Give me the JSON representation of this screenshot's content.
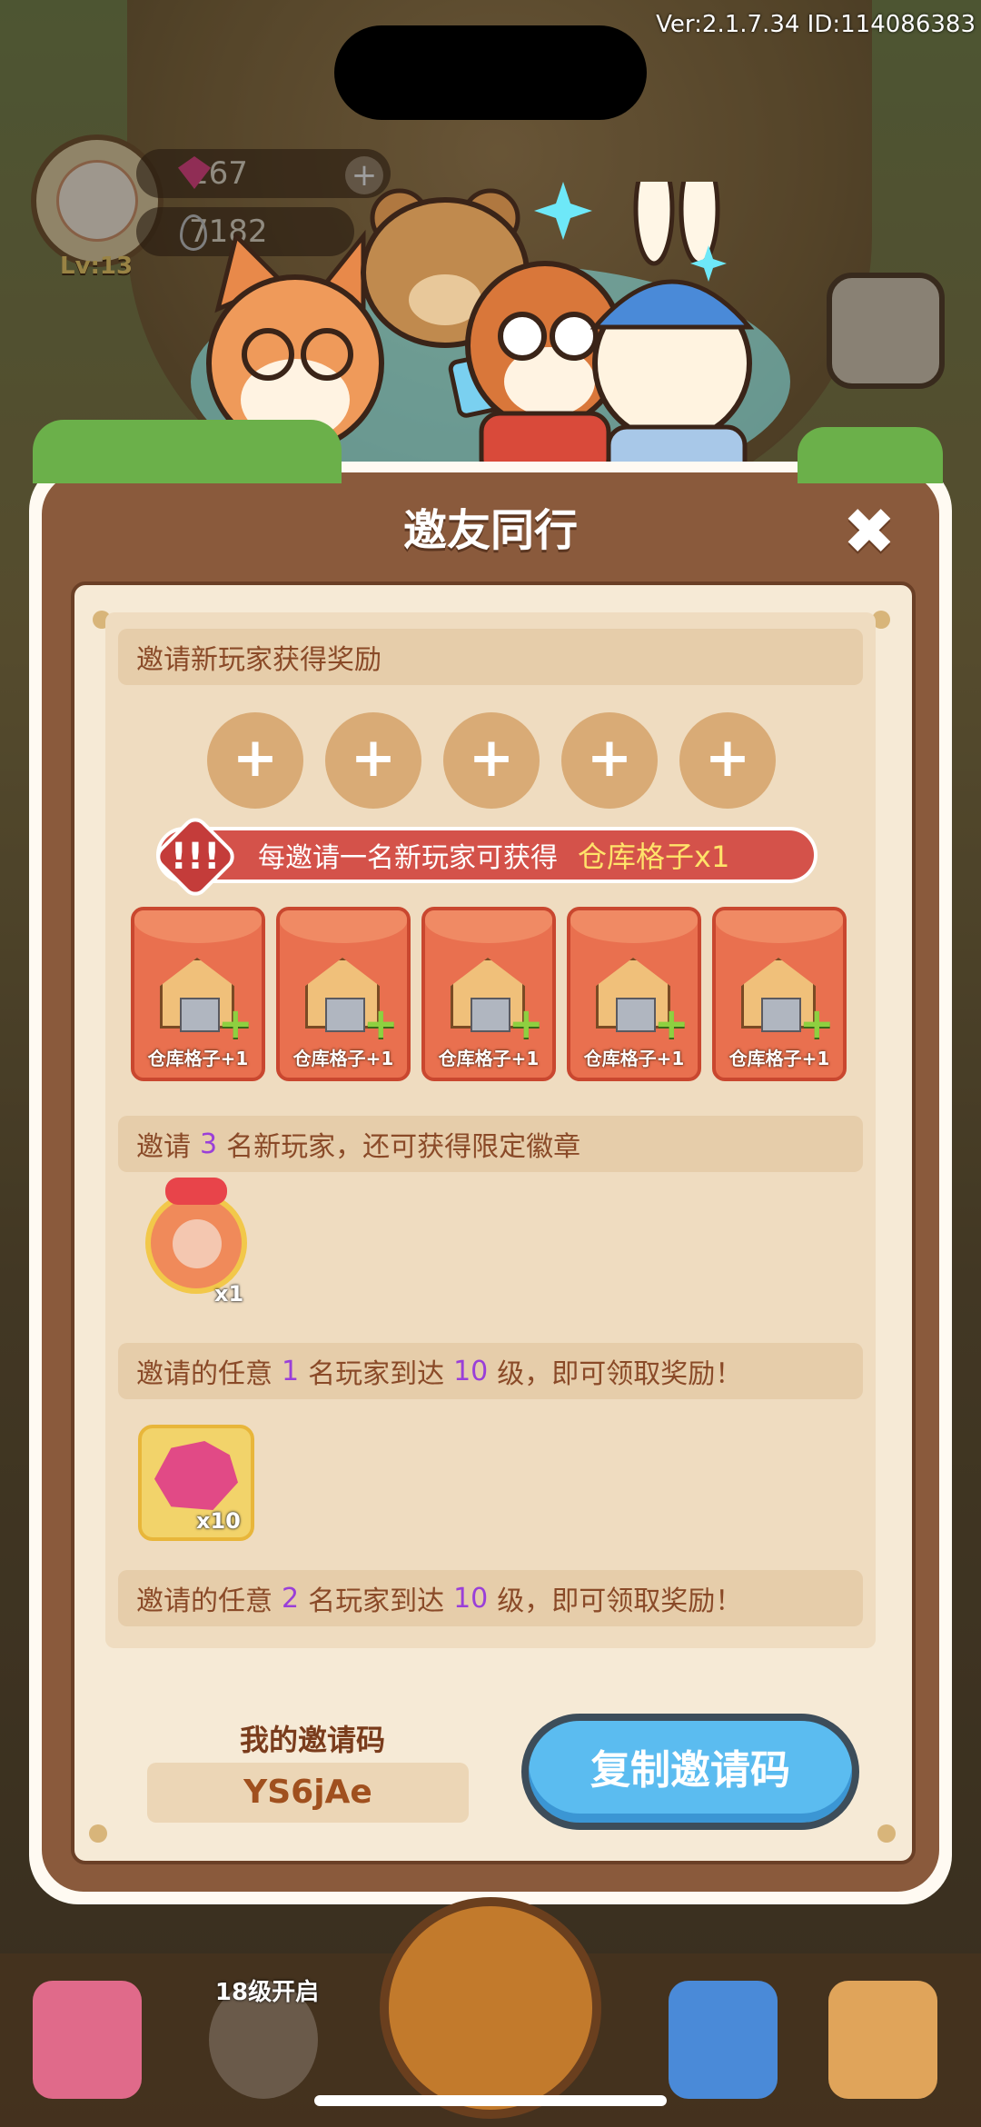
{
  "status": {
    "version_text": "Ver:2.1.7.34 ID:114086383"
  },
  "player": {
    "level": "Lv:13",
    "gems": "167",
    "seeds": "7182"
  },
  "dialog": {
    "title": "邀友同行",
    "close_icon": "close-icon",
    "section_invite_reward": "邀请新玩家获得奖励",
    "invite_slot_label": "+",
    "invite_slots": [
      "+",
      "+",
      "+",
      "+",
      "+"
    ],
    "banner_text": "每邀请一名新玩家可获得",
    "banner_highlight": "仓库格子x1",
    "banner_icon_text": "!!!",
    "reward_cards": [
      {
        "label": "仓库格子+1"
      },
      {
        "label": "仓库格子+1"
      },
      {
        "label": "仓库格子+1"
      },
      {
        "label": "仓库格子+1"
      },
      {
        "label": "仓库格子+1"
      }
    ],
    "badge_section": {
      "prefix": "邀请",
      "count": "3",
      "suffix": "名新玩家，还可获得限定徽章",
      "item_count": "x1"
    },
    "level_reward_1": {
      "prefix": "邀请的任意",
      "players": "1",
      "middle": "名玩家到达",
      "level": "10",
      "suffix": "级，即可领取奖励！",
      "item_count": "x10"
    },
    "level_reward_2": {
      "prefix": "邀请的任意",
      "players": "2",
      "middle": "名玩家到达",
      "level": "10",
      "suffix": "级，即可领取奖励！"
    },
    "my_code_label": "我的邀请码",
    "my_code": "YS6jAe",
    "copy_button": "复制邀请码"
  },
  "bottom_nav": {
    "locked_label": "18级开启"
  },
  "colors": {
    "accent_blue": "#5bbcf0",
    "highlight_purple": "#9a3fd8",
    "banner_red": "#d4524a",
    "panel_brown": "#8a5a3c"
  }
}
